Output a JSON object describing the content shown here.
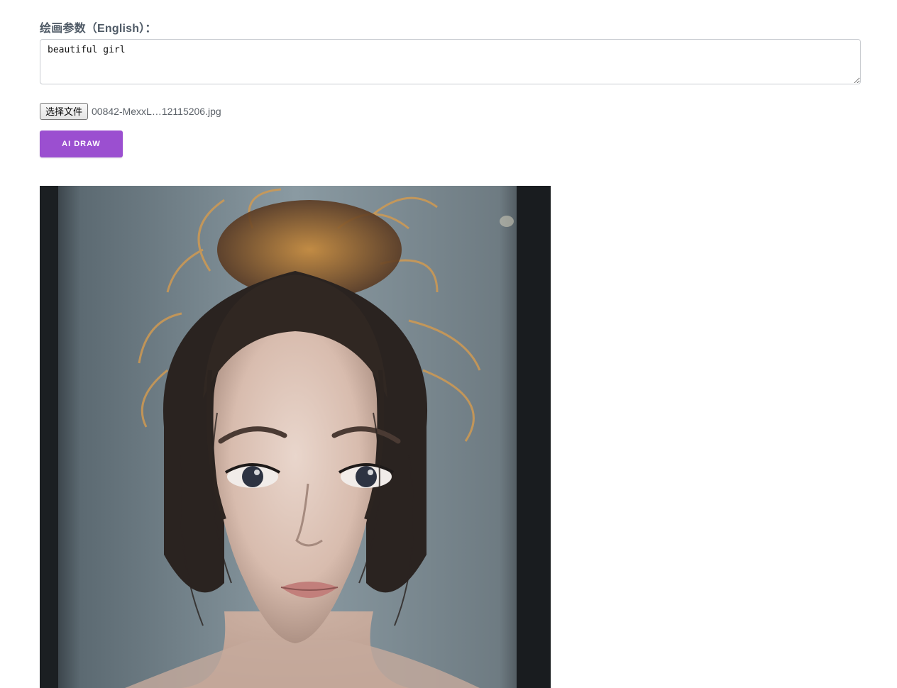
{
  "form": {
    "prompt_label": "绘画参数（English）：",
    "prompt_value": "beautiful girl",
    "file_button_label": "选择文件",
    "file_name": "00842-MexxL…12115206.jpg",
    "draw_button_label": "AI DRAW"
  },
  "colors": {
    "accent": "#9b4fd0",
    "label_text": "#4f5a66"
  },
  "result": {
    "image_icon": "generated-portrait-image"
  }
}
